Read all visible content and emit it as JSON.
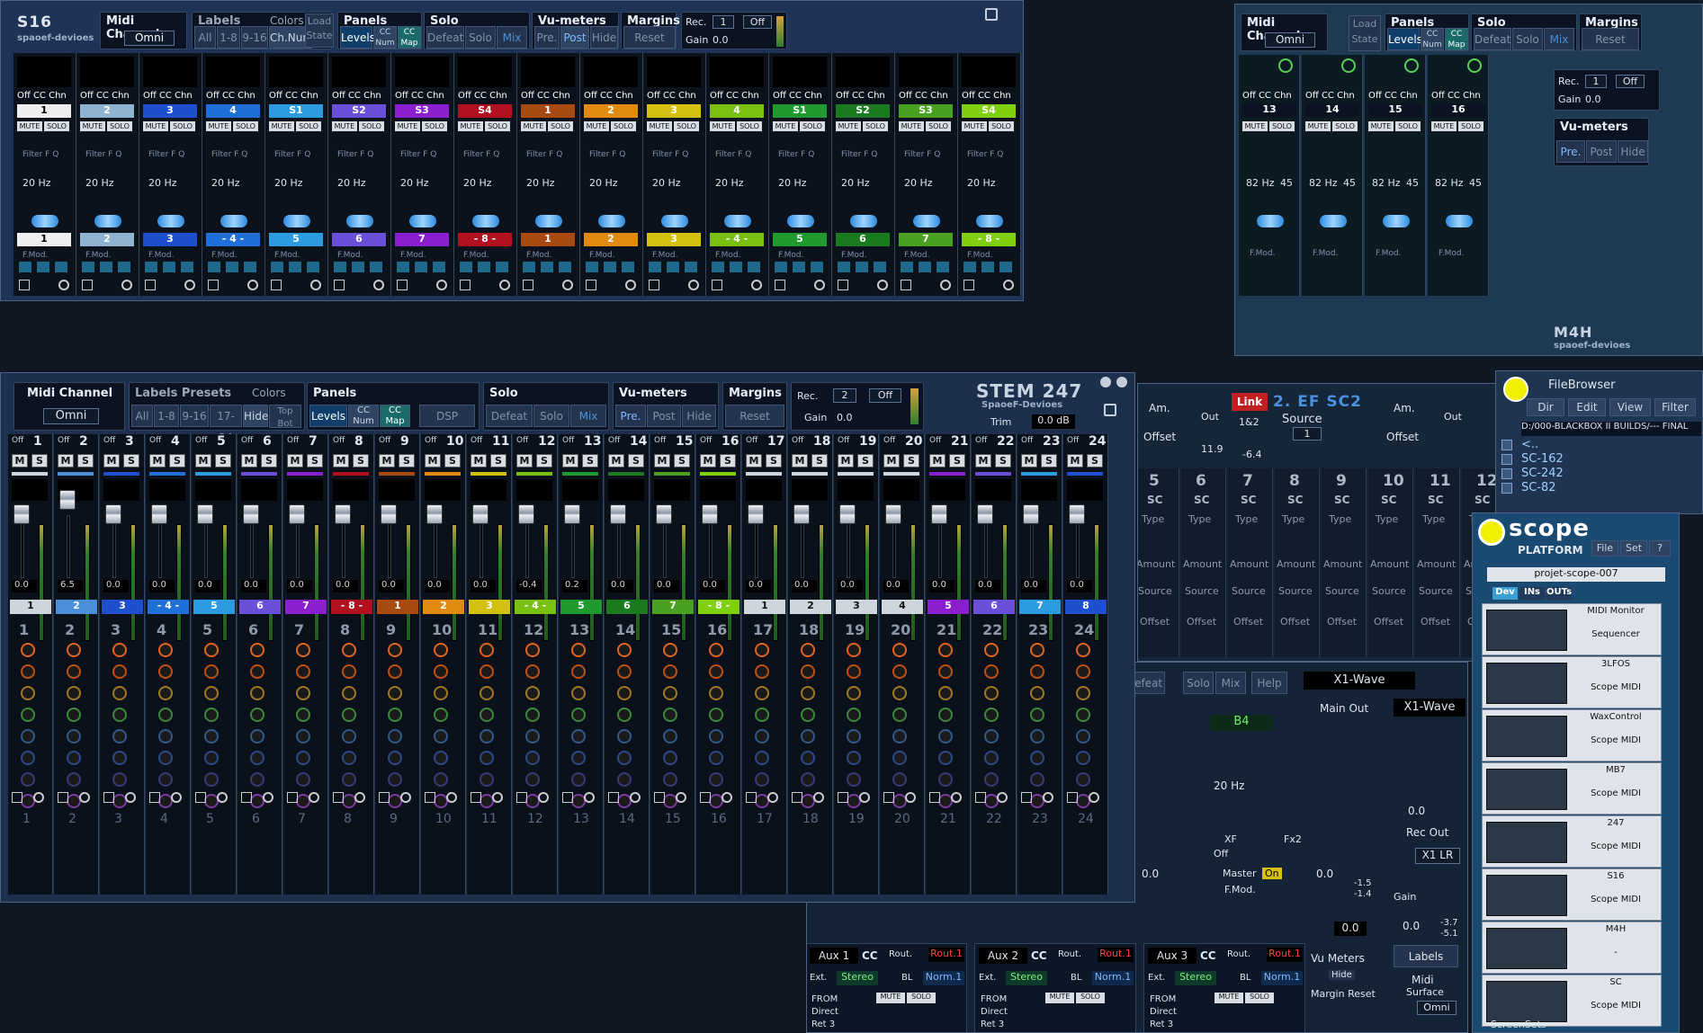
{
  "s16": {
    "title": "S16",
    "subtitle": "spaoef-devioes",
    "midi_channel": "Midi Channel",
    "omni": "Omni",
    "labels": "Labels",
    "colors": "Colors",
    "labels_all": "All",
    "labels_18": "1-8",
    "labels_916": "9-16",
    "ch_num": "Ch.Num",
    "load_state": "Load State",
    "panels": "Panels",
    "levels": "Levels",
    "cc_num": "CC Num",
    "cc_map": "CC Map",
    "solo": "Solo",
    "defeat": "Defeat",
    "solo_btn": "Solo",
    "mix": "Mix",
    "vu": "Vu-meters",
    "pre": "Pre.",
    "post": "Post",
    "hide": "Hide",
    "margins": "Margins",
    "reset": "Reset",
    "rec": "Rec.",
    "rec_val": "1",
    "off": "Off",
    "gain": "Gain",
    "gain_val": "0.0",
    "strips": [
      {
        "label": "1",
        "color": "#eeeeee",
        "bottom": "1"
      },
      {
        "label": "2",
        "color": "#8fb3cf",
        "bottom": "2"
      },
      {
        "label": "3",
        "color": "#1d4fcf",
        "bottom": "3"
      },
      {
        "label": "4",
        "color": "#1f6fd8",
        "bottom": "- 4 -"
      },
      {
        "label": "S1",
        "color": "#2d9be0",
        "bottom": "5"
      },
      {
        "label": "S2",
        "color": "#6b4fd8",
        "bottom": "6"
      },
      {
        "label": "S3",
        "color": "#8b1fd0",
        "bottom": "7"
      },
      {
        "label": "S4",
        "color": "#b01020",
        "bottom": "- 8 -"
      },
      {
        "label": "1",
        "color": "#a84a10",
        "bottom": "1"
      },
      {
        "label": "2",
        "color": "#e08a10",
        "bottom": "2"
      },
      {
        "label": "3",
        "color": "#d4c010",
        "bottom": "3"
      },
      {
        "label": "4",
        "color": "#7ac010",
        "bottom": "- 4 -"
      },
      {
        "label": "S1",
        "color": "#1f9a2f",
        "bottom": "5"
      },
      {
        "label": "S2",
        "color": "#1a7a20",
        "bottom": "6"
      },
      {
        "label": "S3",
        "color": "#4aa020",
        "bottom": "7"
      },
      {
        "label": "S4",
        "color": "#80d010",
        "bottom": "- 8 -"
      }
    ],
    "freq": "20 Hz",
    "off_cc_chn": "Off CC Chn",
    "mute": "MUTE",
    "solo_s": "SOLO",
    "filter": "Filter F Q",
    "fmod": "F.Mod."
  },
  "m4h": {
    "title": "M4H",
    "subtitle": "spaoef-devioes",
    "strips": [
      "13",
      "14",
      "15",
      "16"
    ],
    "freq": "82 Hz",
    "q": "45",
    "midi_channel": "Midi Channel",
    "load_state": "Load State",
    "panels": "Panels",
    "solo": "Solo",
    "margins": "Margins",
    "rec": "Rec.",
    "rec_val": "1",
    "off": "Off",
    "gain": "Gain",
    "gain_val": "0.0",
    "vu": "Vu-meters",
    "pre": "Pre.",
    "post": "Post",
    "hide": "Hide"
  },
  "stem": {
    "title": "STEM 247",
    "subtitle": "SpaoeF-Devioes",
    "trim": "Trim",
    "trim_val": "0.0 dB",
    "midi_channel": "Midi Channel",
    "omni": "Omni",
    "labels_presets": "Labels Presets",
    "colors": "Colors",
    "all": "All",
    "r18": "1-8",
    "r916": "9-16",
    "r1724": "17-24",
    "hide": "Hide",
    "top_bot": "Top Bot",
    "panels": "Panels",
    "levels": "Levels",
    "cc_num": "CC Num",
    "cc_map": "CC Map",
    "dsp": "DSP",
    "solo": "Solo",
    "defeat": "Defeat",
    "solo_btn": "Solo",
    "mix": "Mix",
    "vu": "Vu-meters",
    "pre": "Pre.",
    "post": "Post",
    "vhide": "Hide",
    "margins": "Margins",
    "reset": "Reset",
    "rec": "Rec.",
    "rec_val": "2",
    "off": "Off",
    "gain": "Gain",
    "gain_val": "0.0",
    "m": "M",
    "s": "S",
    "channels": [
      {
        "n": "1",
        "v": "0.0",
        "lab": "1",
        "c": "#cfd5dc"
      },
      {
        "n": "2",
        "v": "6.5",
        "lab": "2",
        "c": "#4b8fd8"
      },
      {
        "n": "3",
        "v": "0.0",
        "lab": "3",
        "c": "#1d4fcf"
      },
      {
        "n": "4",
        "v": "0.0",
        "lab": "- 4 -",
        "c": "#1f6fd8"
      },
      {
        "n": "5",
        "v": "0.0",
        "lab": "5",
        "c": "#2d9be0"
      },
      {
        "n": "6",
        "v": "0.0",
        "lab": "6",
        "c": "#6b4fd8"
      },
      {
        "n": "7",
        "v": "0.0",
        "lab": "7",
        "c": "#8b1fd0"
      },
      {
        "n": "8",
        "v": "0.0",
        "lab": "- 8 -",
        "c": "#b01020"
      },
      {
        "n": "9",
        "v": "0.0",
        "lab": "1",
        "c": "#a84a10"
      },
      {
        "n": "10",
        "v": "0.0",
        "lab": "2",
        "c": "#e08a10"
      },
      {
        "n": "11",
        "v": "0.0",
        "lab": "3",
        "c": "#d4c010"
      },
      {
        "n": "12",
        "v": "-0.4",
        "lab": "- 4 -",
        "c": "#7ac010"
      },
      {
        "n": "13",
        "v": "0.2",
        "lab": "5",
        "c": "#1f9a2f"
      },
      {
        "n": "14",
        "v": "0.0",
        "lab": "6",
        "c": "#1a7a20"
      },
      {
        "n": "15",
        "v": "0.0",
        "lab": "7",
        "c": "#4aa020"
      },
      {
        "n": "16",
        "v": "0.0",
        "lab": "- 8 -",
        "c": "#80d010"
      },
      {
        "n": "17",
        "v": "0.0",
        "lab": "1",
        "c": "#cfd5dc"
      },
      {
        "n": "18",
        "v": "0.0",
        "lab": "2",
        "c": "#cfd5dc"
      },
      {
        "n": "19",
        "v": "0.0",
        "lab": "3",
        "c": "#cfd5dc"
      },
      {
        "n": "20",
        "v": "0.0",
        "lab": "4",
        "c": "#cfd5dc"
      },
      {
        "n": "21",
        "v": "0.0",
        "lab": "5",
        "c": "#8b1fd0"
      },
      {
        "n": "22",
        "v": "0.0",
        "lab": "6",
        "c": "#6b4fd8"
      },
      {
        "n": "23",
        "v": "0.0",
        "lab": "7",
        "c": "#2d9be0"
      },
      {
        "n": "24",
        "v": "0.0",
        "lab": "8",
        "c": "#1d4fcf"
      }
    ]
  },
  "sc2": {
    "link": "Link",
    "title": "2. EF SC2",
    "source": "Source",
    "source_val": "1",
    "am": "Am.",
    "offset": "Offset",
    "out": "Out",
    "out_val": "11.9",
    "ratio": "1&2",
    "ratio_val": "-6.4",
    "cols": [
      "5",
      "6",
      "7",
      "8",
      "9",
      "10",
      "11",
      "12"
    ],
    "sc": "SC",
    "type": "Type",
    "amount": "Amount",
    "source_l": "Source",
    "offset_l": "Offset"
  },
  "x1": {
    "defeat": "Defeat",
    "solo": "Solo",
    "mix": "Mix",
    "help": "Help",
    "name": "X1-Wave",
    "name2": "X1-Wave",
    "main_out": "Main Out",
    "ch_label": "B4",
    "freq": "20 Hz",
    "xf": "XF",
    "fx2": "Fx2",
    "off": "Off",
    "master": "Master",
    "on": "On",
    "fmod": "F.Mod.",
    "val1": "0.0",
    "val2": "0.0",
    "val3": "0.0",
    "rec_out": "Rec Out",
    "x1lr": "X1 LR",
    "gain": "Gain",
    "gv": "0.0",
    "meter1": "-1.5",
    "meter2": "-1.4",
    "mv1": "-3.7",
    "mv2": "-5.1",
    "vu_meters": "Vu Meters",
    "hide": "Hide",
    "margin_reset": "Margin Reset",
    "labels": "Labels",
    "midi": "Midi",
    "surface": "Surface",
    "omni": "Omni",
    "aux": [
      {
        "n": "Aux 1",
        "r": "Rout.1"
      },
      {
        "n": "Aux 2",
        "r": "Rout.1"
      },
      {
        "n": "Aux 3",
        "r": "Rout.1"
      }
    ],
    "cc": "CC",
    "rout": "Rout.",
    "ext": "Ext.",
    "stereo": "Stereo",
    "bl": "BL",
    "norm": "Norm.1",
    "from": "FROM",
    "direct": "Direct",
    "ret": "Ret 3"
  },
  "fb": {
    "title": "FileBrowser",
    "dir": "Dir",
    "edit": "Edit",
    "view": "View",
    "filter": "Filter",
    "path": "D:/000-BLACKBOX II BUILDS/--- FINAL",
    "items": [
      "<..",
      "SC-162",
      "SC-242",
      "SC-82"
    ]
  },
  "scope": {
    "logo": "scope",
    "platform": "PLATFORM",
    "file": "File",
    "set": "Set",
    "q": "?",
    "project": "projet-scope-007",
    "tabs": [
      "Dev",
      "INs",
      "OUTs"
    ],
    "screensets": "ScreenSets",
    "devices": [
      {
        "name": "MIDI Monitor",
        "sub": "Sequencer"
      },
      {
        "name": "3LFOS",
        "sub": "Scope MIDI"
      },
      {
        "name": "WaxControl",
        "sub": "Scope MIDI"
      },
      {
        "name": "MB7",
        "sub": "Scope MIDI"
      },
      {
        "name": "247",
        "sub": "Scope MIDI"
      },
      {
        "name": "S16",
        "sub": "Scope MIDI"
      },
      {
        "name": "M4H",
        "sub": "-"
      },
      {
        "name": "SC",
        "sub": "Scope MIDI"
      }
    ],
    "omni": "omni"
  }
}
